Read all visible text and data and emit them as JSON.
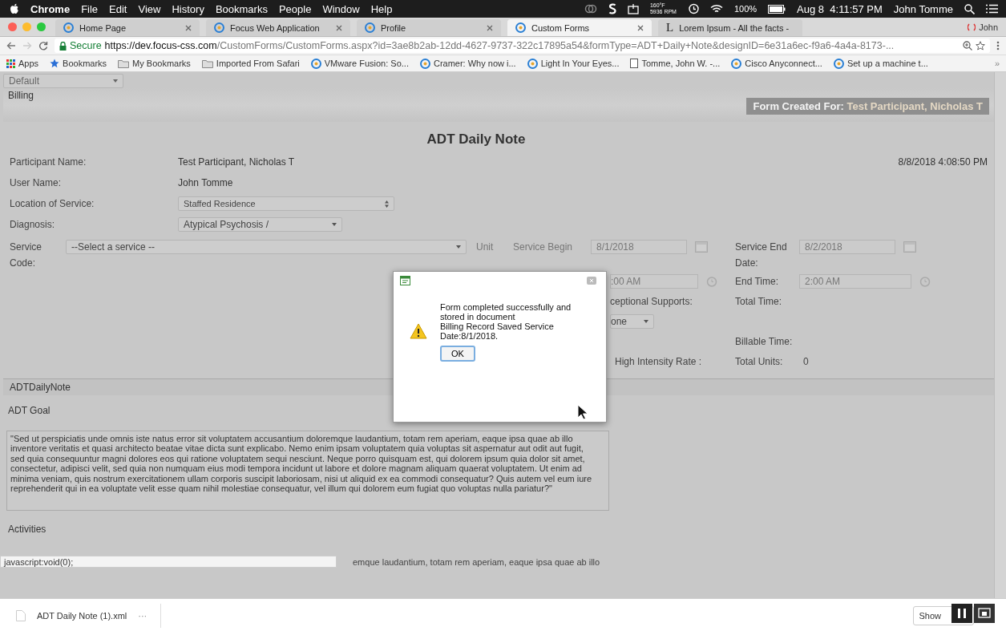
{
  "menubar": {
    "app": "Chrome",
    "menus": [
      "File",
      "Edit",
      "View",
      "History",
      "Bookmarks",
      "People",
      "Window",
      "Help"
    ],
    "temperature": "160°F",
    "fan": "5936 RPM",
    "battery": "100%",
    "clock": "Aug 8  4:11:57 PM",
    "user": "John Tomme"
  },
  "tabs": [
    {
      "title": "Home Page",
      "selected": false,
      "kind": "site"
    },
    {
      "title": "Focus Web Application",
      "selected": false,
      "kind": "site"
    },
    {
      "title": "Profile",
      "selected": false,
      "kind": "site"
    },
    {
      "title": "Custom Forms",
      "selected": true,
      "kind": "site"
    },
    {
      "title": "Lorem Ipsum - All the facts -",
      "selected": false,
      "kind": "letter",
      "icon": "L"
    }
  ],
  "profile": "John",
  "address": {
    "secure": "Secure",
    "host": "https://dev.focus-css.com",
    "path": "/CustomForms/CustomForms.aspx?id=3ae8b2ab-12dd-4627-9737-322c17895a54&formType=ADT+Daily+Note&designID=6e31a6ec-f9a6-4a4a-8173-..."
  },
  "bookmarks": [
    {
      "label": "Apps",
      "kind": "apps"
    },
    {
      "label": "Bookmarks",
      "kind": "star"
    },
    {
      "label": "My Bookmarks",
      "kind": "folder"
    },
    {
      "label": "Imported From Safari",
      "kind": "folder"
    },
    {
      "label": "VMware Fusion: So...",
      "kind": "site"
    },
    {
      "label": "Cramer: Why now i...",
      "kind": "site"
    },
    {
      "label": "Light In Your Eyes...",
      "kind": "site"
    },
    {
      "label": "Tomme, John W. -...",
      "kind": "page"
    },
    {
      "label": "Cisco Anyconnect...",
      "kind": "site"
    },
    {
      "label": "Set up a machine t...",
      "kind": "site"
    }
  ],
  "bookmarks_overflow": "»",
  "form": {
    "view_select": "Default",
    "section": "Billing",
    "created_for": {
      "label": "Form Created For:",
      "name": "Test Participant, Nicholas T"
    },
    "title": "ADT Daily Note",
    "timestamp": "8/8/2018 4:08:50 PM",
    "fields": [
      {
        "label": "Participant Name:",
        "value": "Test Participant, Nicholas T",
        "kind": "text"
      },
      {
        "label": "User Name:",
        "value": "John Tomme",
        "kind": "text"
      },
      {
        "label": "Location of Service:",
        "value": "Staffed Residence",
        "kind": "spinner"
      },
      {
        "label": "Diagnosis:",
        "value": "Atypical Psychosis /",
        "kind": "dropdown"
      }
    ],
    "service_label": "Service Code:",
    "service_select": "--Select a service --",
    "unit_label": "Unit",
    "begin_label": "Service Begin",
    "begin_value": "8/1/2018",
    "end_label": "Service End Date:",
    "end_value": "8/2/2018",
    "start_time": ":00 AM",
    "end_time_label": "End Time:",
    "end_time": "2:00 AM",
    "supports_label": "ceptional Supports:",
    "supports_value": "one",
    "total_time_label": "Total Time:",
    "billable_label": "Billable Time:",
    "high_intensity_label": "High Intensity Rate :",
    "total_units_label": "Total Units:",
    "total_units": "0",
    "note_section": "ADTDailyNote",
    "goal_label": "ADT Goal",
    "goal_text": "\"Sed ut perspiciatis unde omnis iste natus error sit voluptatem accusantium doloremque laudantium, totam rem aperiam, eaque ipsa quae ab illo inventore veritatis et quasi architecto beatae vitae dicta sunt explicabo. Nemo enim ipsam voluptatem quia voluptas sit aspernatur aut odit aut fugit, sed quia consequuntur magni dolores eos qui ratione voluptatem sequi nesciunt. Neque porro quisquam est, qui dolorem ipsum quia dolor sit amet, consectetur, adipisci velit, sed quia non numquam eius modi tempora incidunt ut labore et dolore magnam aliquam quaerat voluptatem. Ut enim ad minima veniam, quis nostrum exercitationem ullam corporis suscipit laboriosam, nisi ut aliquid ex ea commodi consequatur? Quis autem vel eum iure reprehenderit qui in ea voluptate velit esse quam nihil molestiae consequatur, vel illum qui dolorem eum fugiat quo voluptas nulla pariatur?\"",
    "activities_label": "Activities",
    "activities_text": "emque laudantium, totam rem aperiam, eaque ipsa quae ab illo"
  },
  "dialog": {
    "message": "Form completed successfully and stored in document\nBilling Record Saved Service Date:8/1/2018.",
    "ok": "OK"
  },
  "status_url": "javascript:void(0);",
  "downloads": {
    "file": "ADT Daily Note (1).xml",
    "more": "···",
    "show": "Show"
  }
}
